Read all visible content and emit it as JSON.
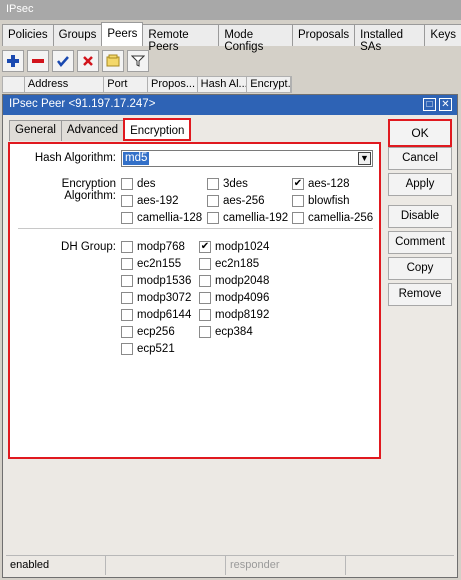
{
  "window": {
    "title": "IPsec"
  },
  "tabs": [
    "Policies",
    "Groups",
    "Peers",
    "Remote Peers",
    "Mode Configs",
    "Proposals",
    "Installed SAs",
    "Keys"
  ],
  "toolbar": {
    "icons": [
      "plus-icon",
      "minus-icon",
      "check-icon",
      "cross-icon",
      "note-icon",
      "filter-icon"
    ]
  },
  "columns": [
    "Address",
    "Port",
    "Propos...",
    "Hash Al...",
    "Encrypt..."
  ],
  "dialog": {
    "title": "IPsec Peer <91.197.17.247>",
    "tabs": [
      "General",
      "Advanced",
      "Encryption"
    ],
    "hash_label": "Hash Algorithm:",
    "hash_value": "md5",
    "enc_label": "Encryption Algorithm:",
    "enc": [
      {
        "label": "des",
        "checked": false
      },
      {
        "label": "3des",
        "checked": false
      },
      {
        "label": "aes-128",
        "checked": true
      },
      {
        "label": "aes-192",
        "checked": false
      },
      {
        "label": "aes-256",
        "checked": false
      },
      {
        "label": "blowfish",
        "checked": false
      },
      {
        "label": "camellia-128",
        "checked": false
      },
      {
        "label": "camellia-192",
        "checked": false
      },
      {
        "label": "camellia-256",
        "checked": false
      }
    ],
    "dh_label": "DH Group:",
    "dh": [
      {
        "label": "modp768",
        "checked": false
      },
      {
        "label": "modp1024",
        "checked": true
      },
      {
        "label": "ec2n155",
        "checked": false
      },
      {
        "label": "ec2n185",
        "checked": false
      },
      {
        "label": "modp1536",
        "checked": false
      },
      {
        "label": "modp2048",
        "checked": false
      },
      {
        "label": "modp3072",
        "checked": false
      },
      {
        "label": "modp4096",
        "checked": false
      },
      {
        "label": "modp6144",
        "checked": false
      },
      {
        "label": "modp8192",
        "checked": false
      },
      {
        "label": "ecp256",
        "checked": false
      },
      {
        "label": "ecp384",
        "checked": false
      },
      {
        "label": "ecp521",
        "checked": false
      }
    ],
    "buttons": [
      "OK",
      "Cancel",
      "Apply",
      "Disable",
      "Comment",
      "Copy",
      "Remove"
    ],
    "status": [
      "enabled",
      "",
      "responder"
    ]
  }
}
